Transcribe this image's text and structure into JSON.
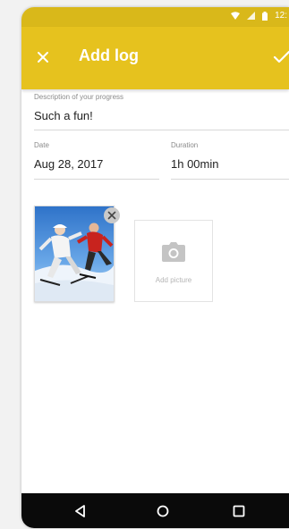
{
  "status_bar": {
    "time": "12:",
    "icons": [
      "wifi-icon",
      "signal-icon",
      "battery-icon"
    ]
  },
  "app_bar": {
    "title": "Add log",
    "close_icon": "close-icon",
    "confirm_icon": "check-icon",
    "color": "#e6c21e"
  },
  "form": {
    "description": {
      "label": "Description of your progress",
      "value": "Such a fun!"
    },
    "date": {
      "label": "Date",
      "value": "Aug 28, 2017"
    },
    "duration": {
      "label": "Duration",
      "value": "1h 00min"
    }
  },
  "photos": {
    "remove_icon": "close-icon",
    "add_picture_label": "Add picture",
    "add_picture_icon": "camera-icon"
  },
  "nav_bar": {
    "buttons": [
      "back-icon",
      "home-icon",
      "recents-icon"
    ]
  }
}
